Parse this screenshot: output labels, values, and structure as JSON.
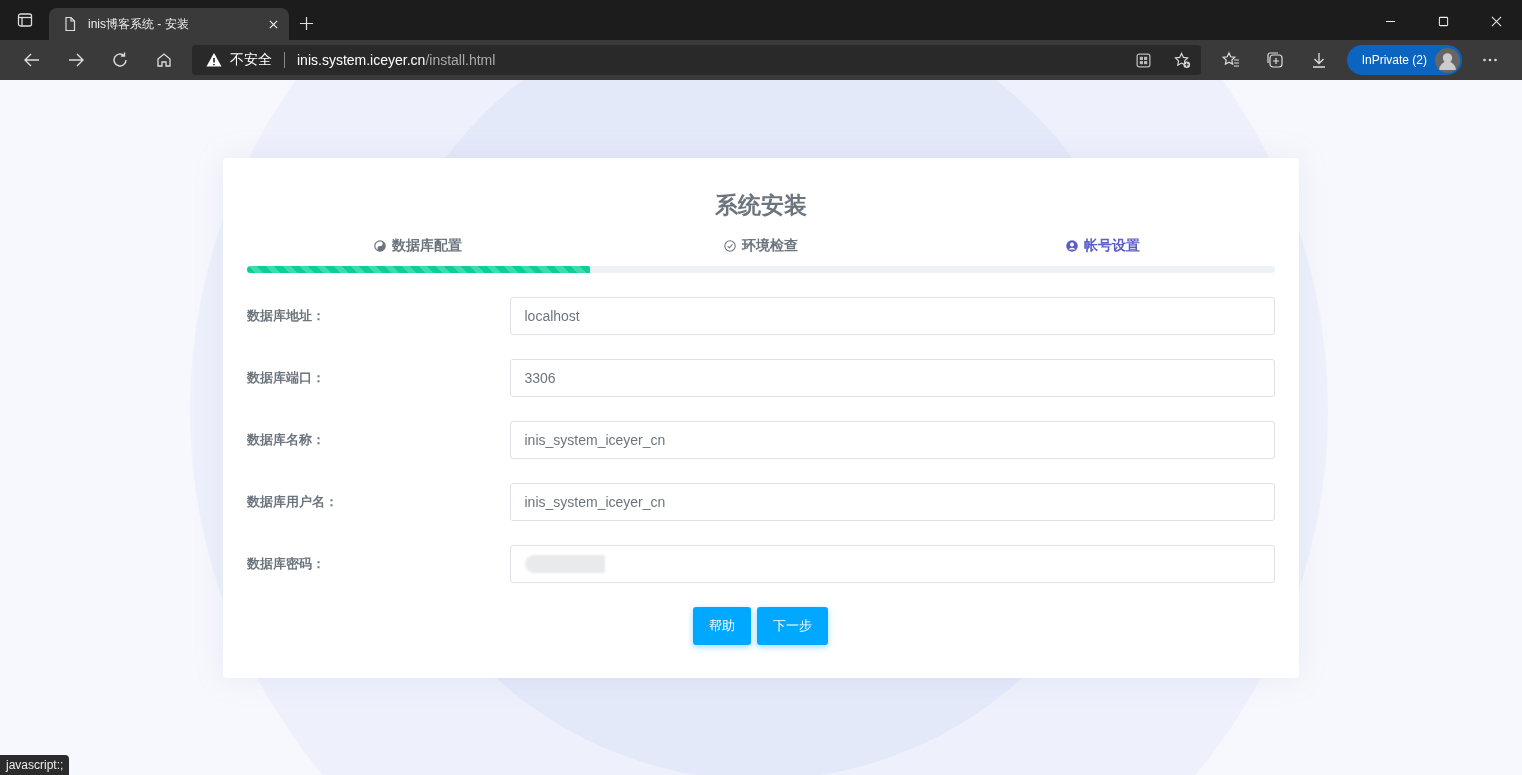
{
  "browser": {
    "tab_title": "inis博客系统 - 安装",
    "security_label": "不安全",
    "url_host": "inis.system.iceyer.cn",
    "url_path": "/install.html",
    "profile_label": "InPrivate (2)"
  },
  "card": {
    "title": "系统安装",
    "steps": [
      {
        "label": "数据库配置",
        "selected": false
      },
      {
        "label": "环境检查",
        "selected": false
      },
      {
        "label": "帐号设置",
        "selected": true
      }
    ],
    "progress": {
      "level": 0.334
    },
    "fields": [
      {
        "label": "数据库地址：",
        "value": "localhost",
        "redacted": false
      },
      {
        "label": "数据库端口：",
        "value": "3306",
        "redacted": false
      },
      {
        "label": "数据库名称：",
        "value": "inis_system_iceyer_cn",
        "redacted": false
      },
      {
        "label": "数据库用户名：",
        "value": "inis_system_iceyer_cn",
        "redacted": false
      },
      {
        "label": "数据库密码：",
        "redacted": true
      }
    ],
    "buttons": [
      "帮助",
      "下一步"
    ]
  },
  "status_bar": {
    "link": "javascript:;"
  }
}
